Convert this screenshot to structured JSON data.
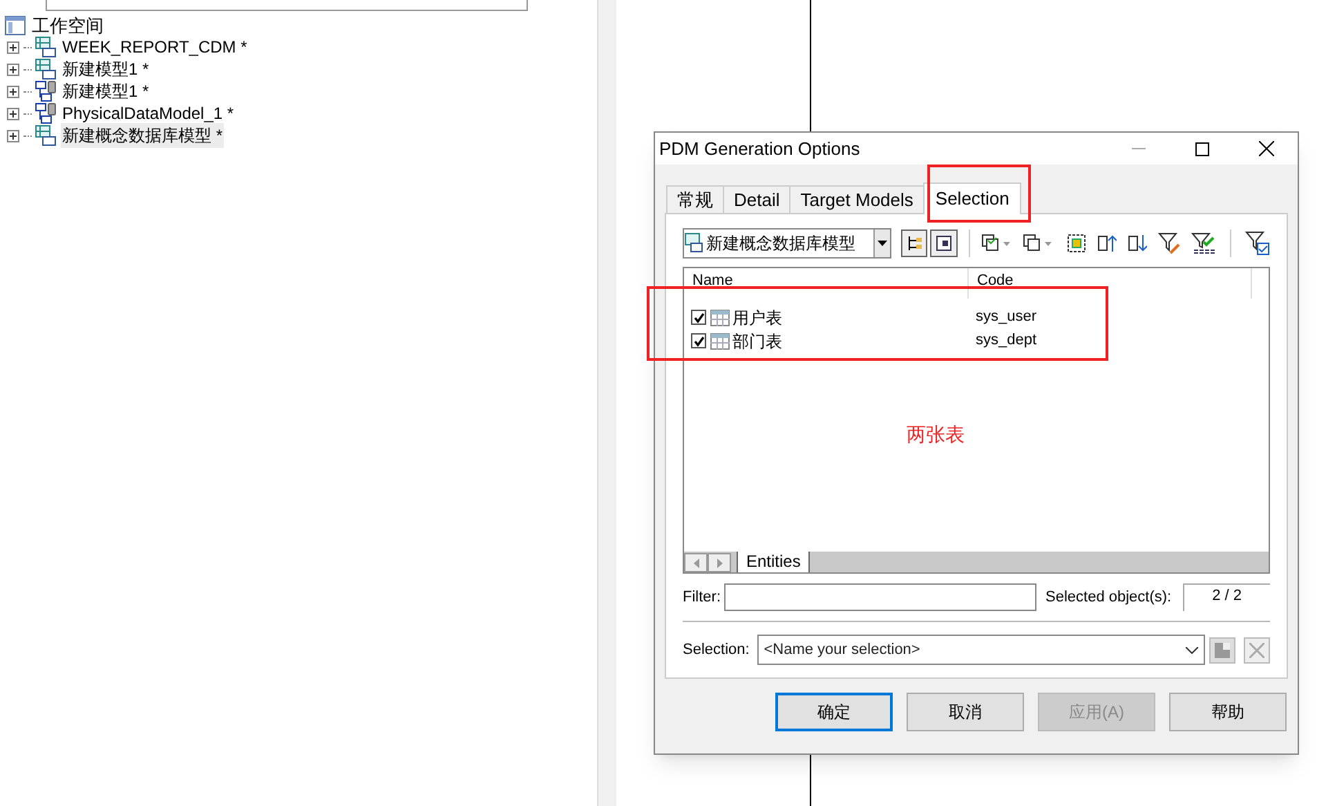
{
  "workspace": {
    "root": "工作空间",
    "items": [
      {
        "label": "WEEK_REPORT_CDM *",
        "kind": "conceptual",
        "selected": false
      },
      {
        "label": "新建模型1 *",
        "kind": "conceptual",
        "selected": false
      },
      {
        "label": "新建模型1 *",
        "kind": "physical",
        "selected": false
      },
      {
        "label": "PhysicalDataModel_1 *",
        "kind": "physical",
        "selected": false
      },
      {
        "label": "新建概念数据库模型 *",
        "kind": "conceptual",
        "selected": true
      }
    ]
  },
  "dialog": {
    "title": "PDM Generation Options",
    "tabs": [
      {
        "label": "常规",
        "selected": false
      },
      {
        "label": "Detail",
        "selected": false
      },
      {
        "label": "Target Models",
        "selected": false
      },
      {
        "label": "Selection",
        "selected": true
      }
    ],
    "model_dropdown": "新建概念数据库模型",
    "columns": [
      "Name",
      "Code"
    ],
    "rows": [
      {
        "name": "用户表",
        "code": "sys_user",
        "checked": true
      },
      {
        "name": "部门表",
        "code": "sys_dept",
        "checked": true
      }
    ],
    "sheet_tab": "Entities",
    "filter_label": "Filter:",
    "selected_label": "Selected object(s):",
    "selected_count": "2 / 2",
    "selection_label": "Selection:",
    "selection_placeholder": "<Name your selection>",
    "buttons": [
      {
        "label": "确定",
        "disabled": false,
        "default": true
      },
      {
        "label": "取消",
        "disabled": false,
        "default": false
      },
      {
        "label": "应用(A)",
        "disabled": true,
        "default": false
      },
      {
        "label": "帮助",
        "disabled": false,
        "default": false
      }
    ]
  },
  "annotation": "两张表"
}
